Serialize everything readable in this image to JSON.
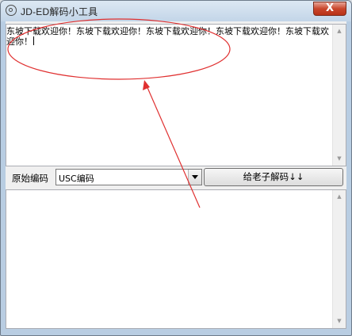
{
  "window": {
    "title": "JD-ED解码小工具",
    "close_label": "X"
  },
  "input_area": {
    "text": "东坡下载欢迎你！东坡下载欢迎你！东坡下载欢迎你！东坡下载欢迎你！东坡下载欢迎你！"
  },
  "controls": {
    "source_encoding_label": "原始编码",
    "encoding_select_value": "USC编码",
    "decode_button_label": "给老子解码↓↓"
  },
  "output_area": {
    "text": ""
  },
  "colors": {
    "annotation_red": "#e03030",
    "close_button": "#c9462c"
  }
}
